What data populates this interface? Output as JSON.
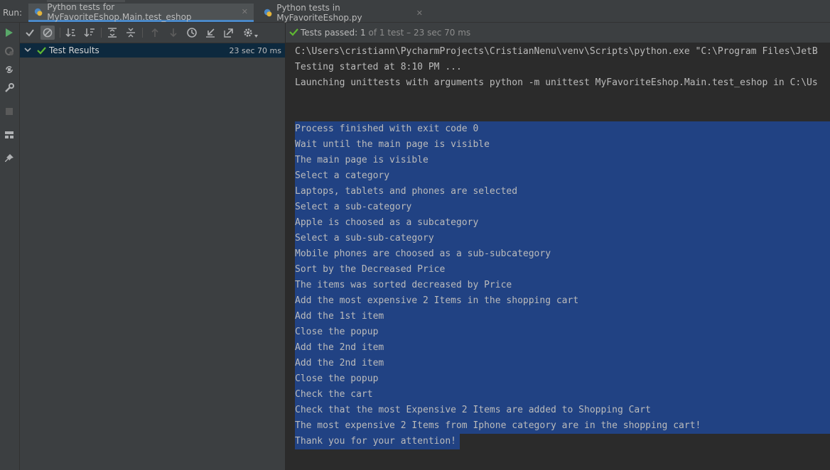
{
  "run_panel": {
    "run_label": "Run:",
    "tabs": [
      {
        "label": "Python tests for MyFavoriteEshop.Main.test_eshop",
        "active": true
      },
      {
        "label": "Python tests in MyFavoriteEshop.py",
        "active": false
      }
    ]
  },
  "tree": {
    "root": {
      "label": "Test Results",
      "duration": "23 sec 70 ms",
      "status": "passed"
    }
  },
  "status": {
    "prefix": "Tests passed: ",
    "count": "1",
    "detail": " of 1 test – 23 sec 70 ms"
  },
  "console": {
    "header_lines": [
      "C:\\Users\\cristiann\\PycharmProjects\\CristianNenu\\venv\\Scripts\\python.exe \"C:\\Program Files\\JetB",
      "Testing started at 8:10 PM ...",
      "Launching unittests with arguments python -m unittest MyFavoriteEshop.Main.test_eshop in C:\\Us"
    ],
    "output_lines": [
      "Process finished with exit code 0",
      "Wait until the main page is visible",
      "The main page is visible",
      "Select a category",
      "Laptops, tablets and phones are selected",
      "Select a sub-category",
      "Apple is choosed as a subcategory",
      "Select a sub-sub-category",
      "Mobile phones are choosed as a sub-subcategory",
      "Sort by the Decreased Price",
      "The items was sorted decreased by Price",
      "Add the most expensive 2 Items in the shopping cart",
      "Add the 1st item",
      "Close the popup",
      "Add the 2nd item",
      "Add the 2nd item",
      "Close the popup",
      "Check the cart",
      "Check that the most Expensive 2 Items are added to Shopping Cart",
      "The most expensive 2 Items from Iphone category are in the shopping cart!",
      "Thank you for your attention!"
    ]
  },
  "colors": {
    "passed": "#5fb832",
    "selection": "#214283",
    "run_green": "#59a869"
  }
}
